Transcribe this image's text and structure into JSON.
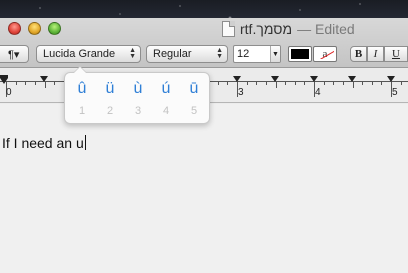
{
  "window": {
    "title": "rtf.מסמך",
    "status": "— Edited",
    "document_icon": "rtf-document-icon"
  },
  "traffic_lights": {
    "close": "close-button",
    "minimize": "minimize-button",
    "zoom": "zoom-button"
  },
  "formatbar": {
    "paragraph_label": "¶▾",
    "font_family": "Lucida Grande",
    "font_style": "Regular",
    "font_size": "12",
    "text_color": "#000000",
    "bold_label": "B",
    "italic_label": "I",
    "underline_label": "U",
    "bg_swatch_label": "a"
  },
  "ruler": {
    "numbers": [
      "0",
      "3",
      "4",
      "5"
    ]
  },
  "document": {
    "text": "If I need an u"
  },
  "accent_popup": {
    "options": [
      {
        "char": "û",
        "key": "1"
      },
      {
        "char": "ü",
        "key": "2"
      },
      {
        "char": "ù",
        "key": "3"
      },
      {
        "char": "ú",
        "key": "4"
      },
      {
        "char": "ū",
        "key": "5"
      }
    ],
    "accent_color": "#2f7fd6"
  }
}
